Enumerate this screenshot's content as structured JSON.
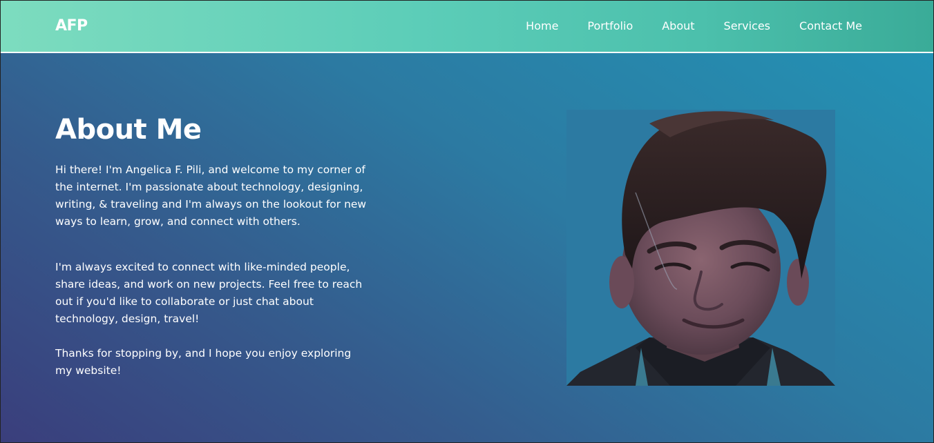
{
  "navbar": {
    "logo": "AFP",
    "links": [
      "Home",
      "Portfolio",
      "About",
      "Services",
      "Contact Me"
    ]
  },
  "about": {
    "title": "About Me",
    "paragraphs": [
      "Hi there! I'm Angelica F. Pili, and welcome to my corner of the internet. I'm passionate about technology, designing, writing, & traveling and I'm always on the lookout for new ways to learn, grow, and connect with others.",
      "I'm always excited to connect with like-minded people, share ideas, and work on new projects. Feel free to reach out if you'd like to collaborate or just chat about technology, design, travel!",
      "Thanks for stopping by, and I hope you enjoy exploring my website!"
    ]
  },
  "colors": {
    "navbar_start": "#7ddcbf",
    "navbar_end": "#3aab98",
    "hero_start": "#3a3e7c",
    "hero_end": "#2392b4",
    "text": "#ffffff"
  }
}
